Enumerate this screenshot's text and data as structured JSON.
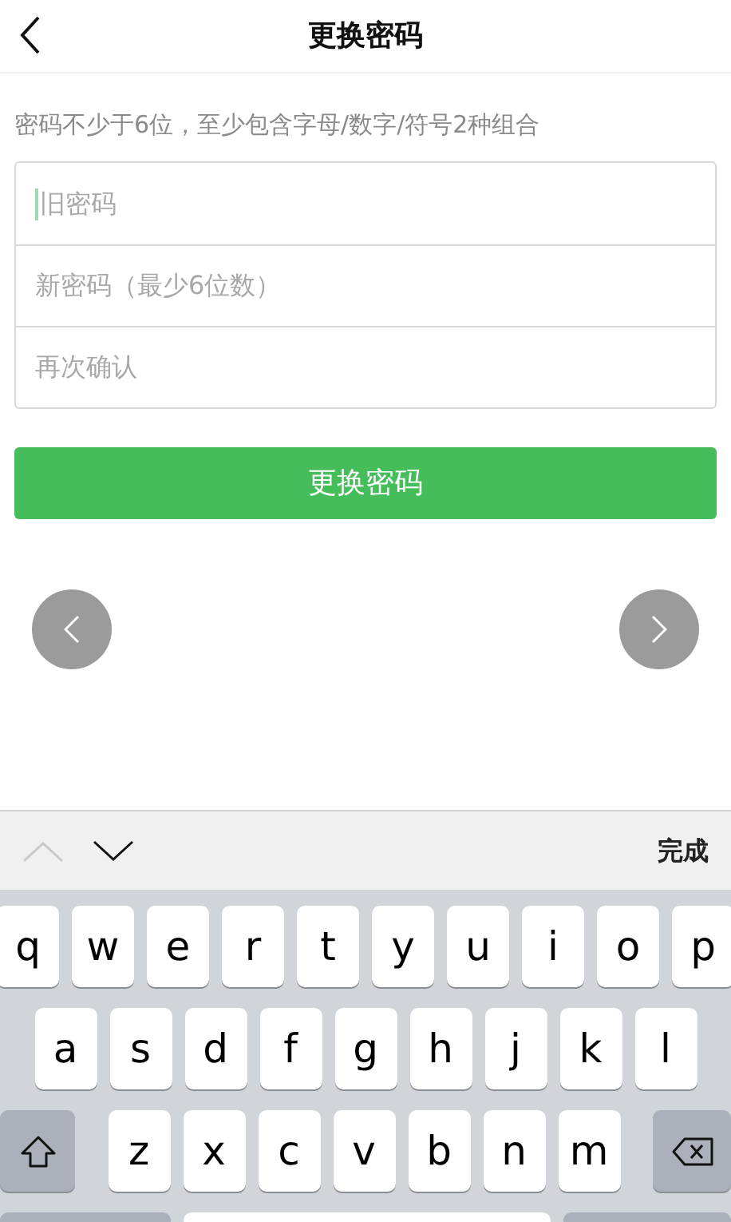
{
  "header": {
    "title": "更换密码"
  },
  "hint": "密码不少于6位，至少包含字母/数字/符号2种组合",
  "fields": [
    {
      "placeholder": "旧密码",
      "focused": true
    },
    {
      "placeholder": "新密码（最少6位数）",
      "focused": false
    },
    {
      "placeholder": "再次确认",
      "focused": false
    }
  ],
  "submit_button": "更换密码",
  "keyboard_toolbar": {
    "prev_disabled": true,
    "next_disabled": false,
    "done": "完成"
  },
  "keyboard": {
    "rows": [
      [
        "q",
        "w",
        "e",
        "r",
        "t",
        "y",
        "u",
        "i",
        "o",
        "p"
      ],
      [
        "a",
        "s",
        "d",
        "f",
        "g",
        "h",
        "j",
        "k",
        "l"
      ],
      [
        "z",
        "x",
        "c",
        "v",
        "b",
        "n",
        "m"
      ]
    ]
  }
}
